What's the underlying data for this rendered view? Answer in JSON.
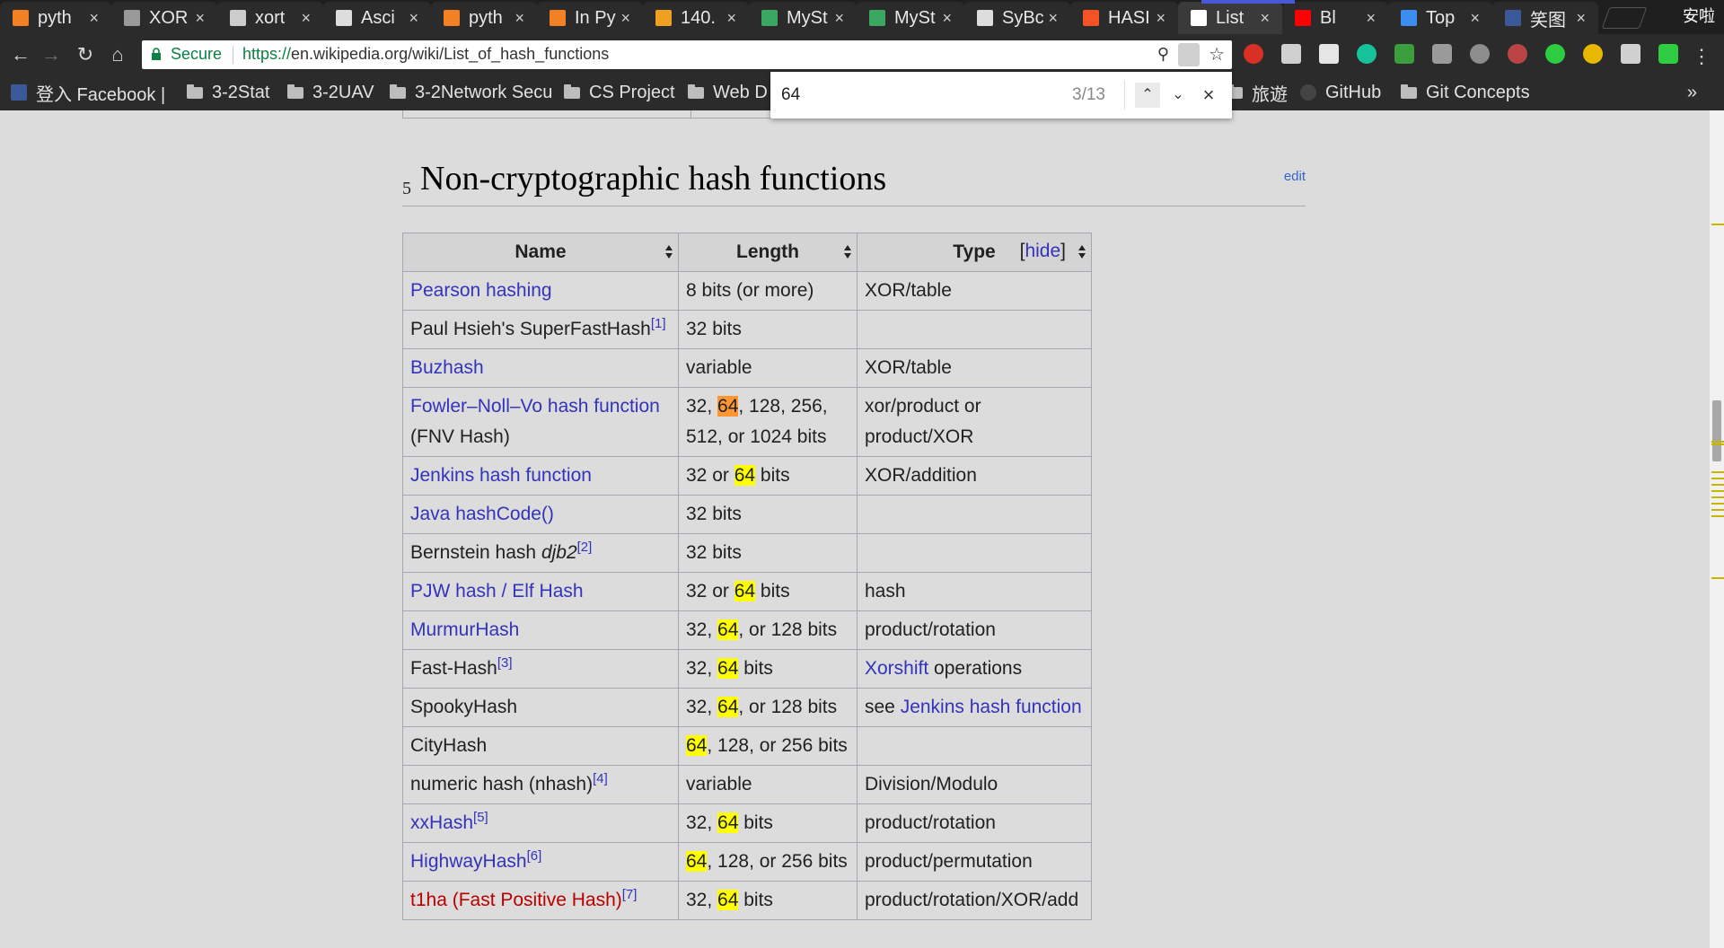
{
  "browser": {
    "tabs": [
      {
        "title": "pyth",
        "icon": "stack-overflow-icon"
      },
      {
        "title": "XOR",
        "icon": "blank-page-icon"
      },
      {
        "title": "xort",
        "icon": "bug-icon"
      },
      {
        "title": "Asci",
        "icon": "document-icon"
      },
      {
        "title": "pyth",
        "icon": "stack-overflow-icon"
      },
      {
        "title": "In Py",
        "icon": "stack-overflow-icon"
      },
      {
        "title": "140.",
        "icon": "ship-icon"
      },
      {
        "title": "MySt",
        "icon": "t-icon"
      },
      {
        "title": "MySt",
        "icon": "t-icon"
      },
      {
        "title": "SyBc",
        "icon": "document-icon"
      },
      {
        "title": "HASI",
        "icon": "windows-icon"
      },
      {
        "title": "List",
        "icon": "wikipedia-icon",
        "active": true
      },
      {
        "title": "Bl",
        "icon": "youtube-icon"
      },
      {
        "title": "Top",
        "icon": "x-app-icon"
      },
      {
        "title": "笑图",
        "icon": "facebook-icon"
      }
    ],
    "profile_name": "安啦",
    "secure_label": "Secure",
    "url_scheme": "https://",
    "url_rest": "en.wikipedia.org/wiki/List_of_hash_functions",
    "bookmarks": [
      {
        "label": "登入 Facebook |",
        "icon": "facebook-icon"
      },
      {
        "label": "3-2Stat",
        "icon": "folder-icon"
      },
      {
        "label": "3-2UAV",
        "icon": "folder-icon"
      },
      {
        "label": "3-2Network Secu",
        "icon": "folder-icon"
      },
      {
        "label": "CS Project",
        "icon": "folder-icon"
      },
      {
        "label": "Web D",
        "icon": "folder-icon"
      },
      {
        "label": "旅遊",
        "icon": "folder-icon"
      },
      {
        "label": "GitHub",
        "icon": "github-icon"
      },
      {
        "label": "Git Concepts",
        "icon": "folder-icon"
      }
    ],
    "overflow_label": "»"
  },
  "find_bar": {
    "query": "64",
    "count": "3/13"
  },
  "page": {
    "section_number": "5",
    "section_title": "Non-cryptographic hash functions",
    "edit_label": "edit",
    "table": {
      "headers": [
        "Name",
        "Length",
        "Type"
      ],
      "hide_label": "hide",
      "rows": [
        {
          "name": "Pearson hashing",
          "name_link": true,
          "length": "8 bits (or more)",
          "type": "XOR/table"
        },
        {
          "name": "Paul Hsieh's SuperFastHash",
          "ref": "[1]",
          "length": "32 bits",
          "type": ""
        },
        {
          "name": "Buzhash",
          "name_link": true,
          "length": "variable",
          "type": "XOR/table"
        },
        {
          "name": "Fowler–Noll–Vo hash function",
          "name_link": true,
          "name_suffix": "(FNV Hash)",
          "length": "32, 64, 128, 256, 512, or 1024 bits",
          "type": "xor/product or product/XOR"
        },
        {
          "name": "Jenkins hash function",
          "name_link": true,
          "length": "32 or 64 bits",
          "type": "XOR/addition"
        },
        {
          "name": "Java hashCode()",
          "name_link": true,
          "length": "32 bits",
          "type": ""
        },
        {
          "name": "Bernstein hash",
          "name_italic": "djb2",
          "ref": "[2]",
          "length": "32 bits",
          "type": ""
        },
        {
          "name": "PJW hash / Elf Hash",
          "name_link": true,
          "length": "32 or 64 bits",
          "type": "hash"
        },
        {
          "name": "MurmurHash",
          "name_link": true,
          "length": "32, 64, or 128 bits",
          "type": "product/rotation"
        },
        {
          "name": "Fast-Hash",
          "ref": "[3]",
          "length": "32, 64 bits",
          "type_link": "Xorshift",
          "type": " operations"
        },
        {
          "name": "SpookyHash",
          "length": "32, 64, or 128 bits",
          "type": "see ",
          "type_link_after": "Jenkins hash function"
        },
        {
          "name": "CityHash",
          "length": "64, 128, or 256 bits",
          "type": ""
        },
        {
          "name": "numeric hash (nhash)",
          "ref": "[4]",
          "length": "variable",
          "type": "Division/Modulo"
        },
        {
          "name": "xxHash",
          "name_link": true,
          "ref": "[5]",
          "length": "32, 64 bits",
          "type": "product/rotation"
        },
        {
          "name": "HighwayHash",
          "name_link": true,
          "ref": "[6]",
          "length": "64, 128, or 256 bits",
          "type": "product/permutation"
        },
        {
          "name": "t1ha (Fast Positive Hash)",
          "name_link": true,
          "redlink": true,
          "ref": "[7]",
          "length": "32, 64 bits",
          "type": "product/rotation/XOR/add"
        }
      ]
    }
  },
  "colors": {
    "link": "#3333bb",
    "redlink": "#ba0000",
    "find_highlight": "#ffff00",
    "find_current": "#ff9632"
  }
}
